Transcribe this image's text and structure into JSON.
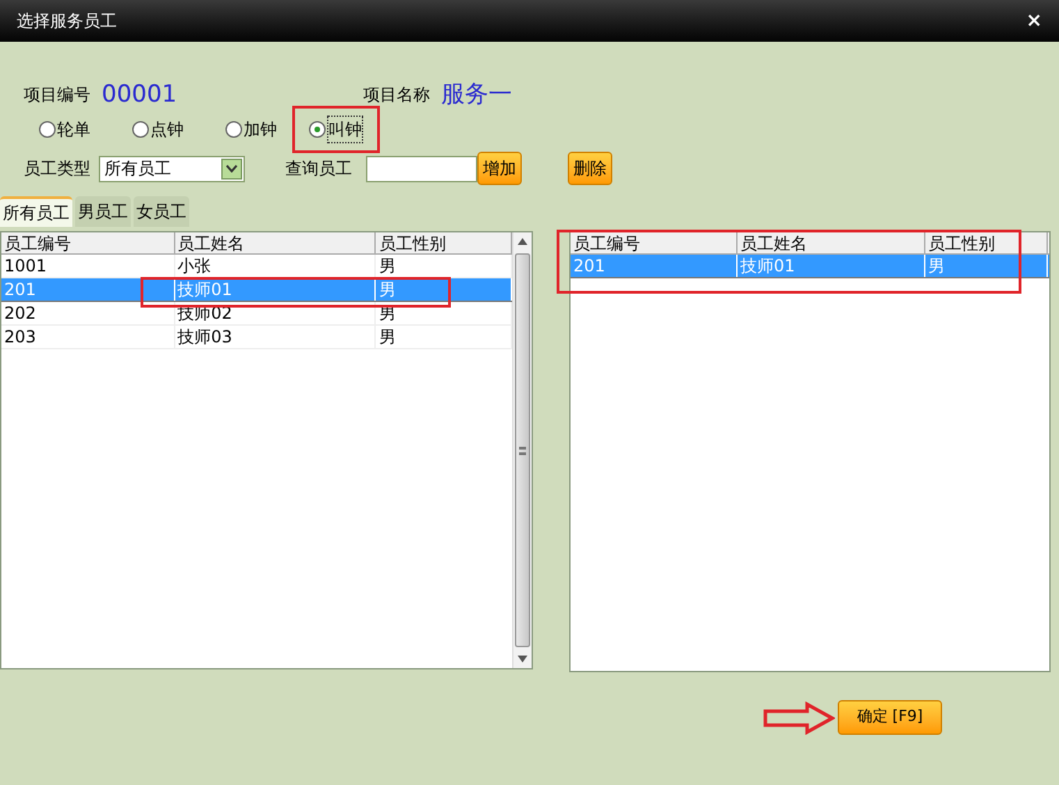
{
  "window": {
    "title": "选择服务员工",
    "close": "×"
  },
  "item_number": {
    "label": "项目编号",
    "value": "00001"
  },
  "item_name": {
    "label": "项目名称",
    "value": "服务一"
  },
  "call_modes": [
    {
      "label": "轮单",
      "selected": false
    },
    {
      "label": "点钟",
      "selected": false
    },
    {
      "label": "加钟",
      "selected": false
    },
    {
      "label": "叫钟",
      "selected": true
    }
  ],
  "employee_type": {
    "label": "员工类型",
    "value": "所有员工"
  },
  "search": {
    "label": "查询员工"
  },
  "add_button": "增加",
  "delete_button": "删除",
  "tabs": [
    {
      "label": "所有员工",
      "selected": true
    },
    {
      "label": "男员工",
      "selected": false
    },
    {
      "label": "女员工",
      "selected": false
    }
  ],
  "employee_table": {
    "columns": [
      "员工编号",
      "员工姓名",
      "员工性别"
    ],
    "rows": [
      {
        "cells": [
          "1001",
          "小张",
          "男"
        ],
        "selected": false
      },
      {
        "cells": [
          "201",
          "技师01",
          "男"
        ],
        "selected": true
      },
      {
        "cells": [
          "202",
          "技师02",
          "男"
        ],
        "selected": false
      },
      {
        "cells": [
          "203",
          "技师03",
          "男"
        ],
        "selected": false
      }
    ]
  },
  "chosen_table": {
    "columns": [
      "员工编号",
      "员工姓名",
      "员工性别"
    ],
    "rows": [
      {
        "cells": [
          "201",
          "技师01",
          "男"
        ],
        "selected": true
      }
    ]
  },
  "confirm_button": "确定 [F9]"
}
